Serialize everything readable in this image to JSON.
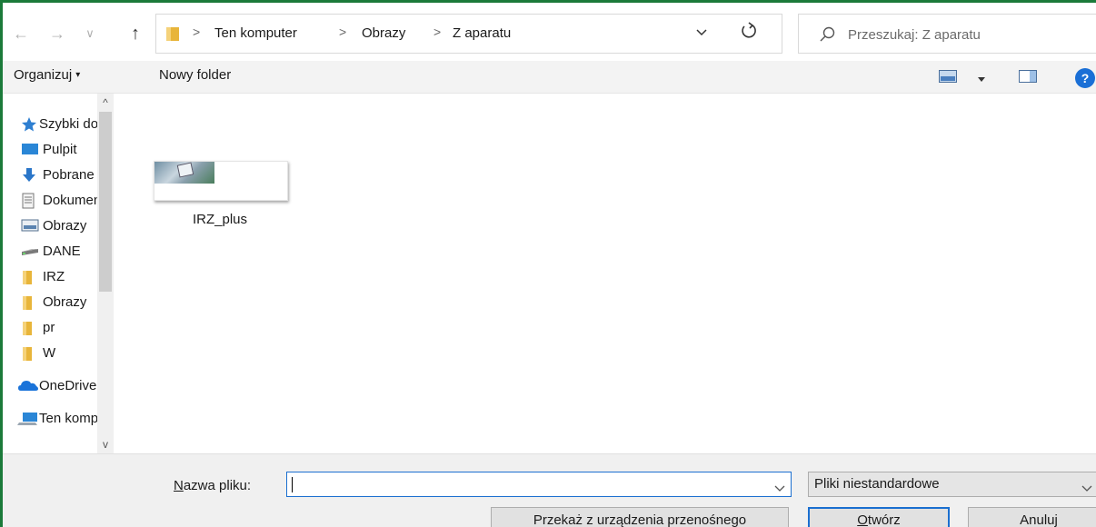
{
  "address_bar": {
    "back_label": "←",
    "forward_label": "→",
    "history_label": "∨",
    "up_label": "↑",
    "breadcrumbs": [
      "Ten komputer",
      "Obrazy",
      "Z aparatu"
    ],
    "separator": ">",
    "search_placeholder": "Przeszukaj: Z aparatu"
  },
  "toolbar": {
    "organize_label": "Organizuj",
    "organize_caret": "▾",
    "new_folder_label": "Nowy folder",
    "help_label": "?"
  },
  "nav_pane": {
    "items": [
      {
        "icon": "star-icon",
        "label": "Szybki dostęp"
      },
      {
        "icon": "desktop-icon",
        "label": "Pulpit"
      },
      {
        "icon": "download-icon",
        "label": "Pobrane"
      },
      {
        "icon": "document-icon",
        "label": "Dokumenty"
      },
      {
        "icon": "pictures-icon",
        "label": "Obrazy"
      },
      {
        "icon": "drive-icon",
        "label": "DANE"
      },
      {
        "icon": "folder-icon",
        "label": "IRZ"
      },
      {
        "icon": "folder-icon",
        "label": "Obrazy"
      },
      {
        "icon": "folder-icon",
        "label": "pr"
      },
      {
        "icon": "folder-icon",
        "label": "W"
      },
      {
        "icon": "onedrive-icon",
        "label": "OneDrive"
      },
      {
        "icon": "computer-icon",
        "label": "Ten komputer"
      }
    ],
    "scroll_up": "^",
    "scroll_down": "v"
  },
  "content": {
    "files": [
      {
        "name": "IRZ_plus",
        "icon": "image-thumbnail-icon"
      }
    ]
  },
  "footer": {
    "filename_label_underlined": "N",
    "filename_label_rest": "azwa pliku:",
    "filename_value": "",
    "file_type_selected": "Pliki niestandardowe",
    "portable_button": "Przekaż z urządzenia przenośnego",
    "open_button_underlined": "O",
    "open_button_rest": "twórz",
    "cancel_button": "Anuluj"
  },
  "colors": {
    "accent": "#1b6fd0",
    "frame": "#1b7a3a",
    "folder": "#e8b53a",
    "toolbar_bg": "#f3f3f3",
    "footer_bg": "#f0f0f0"
  }
}
